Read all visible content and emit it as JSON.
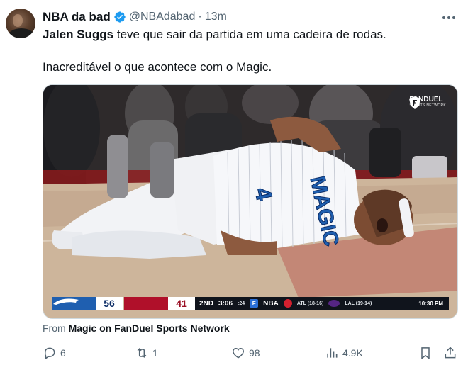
{
  "author": {
    "name": "NBA da bad",
    "handle": "@NBAdabad",
    "separator": "·",
    "time": "13m"
  },
  "tweet": {
    "line1_bold": "Jalen Suggs",
    "line1_rest": " teve que sair da partida em uma cadeira de rodas.",
    "line2": "Inacreditável o que acontece com o Magic."
  },
  "media": {
    "brand_line1": "FANDUEL",
    "brand_line2": "SPORTS NETWORK",
    "jersey_text": "MAGIC",
    "jersey_number": "4",
    "scoreboard": {
      "home_score": "56",
      "away_score": "41",
      "quarter": "2ND",
      "clock": "3:06",
      "shot_clock": ":24",
      "network": "NBA",
      "game1": "ATL (18-16)",
      "game2": "LAL (19-14)",
      "broadcast_time": "10:30 PM"
    }
  },
  "source": {
    "prefix": "From ",
    "name": "Magic on FanDuel Sports Network"
  },
  "actions": {
    "replies": "6",
    "retweets": "1",
    "likes": "98",
    "views": "4.9K"
  },
  "colors": {
    "text_primary": "#0f1419",
    "text_secondary": "#536471",
    "verified_blue": "#1d9bf0",
    "magic_blue": "#1f5fb0",
    "raptors_red": "#b0102a"
  }
}
